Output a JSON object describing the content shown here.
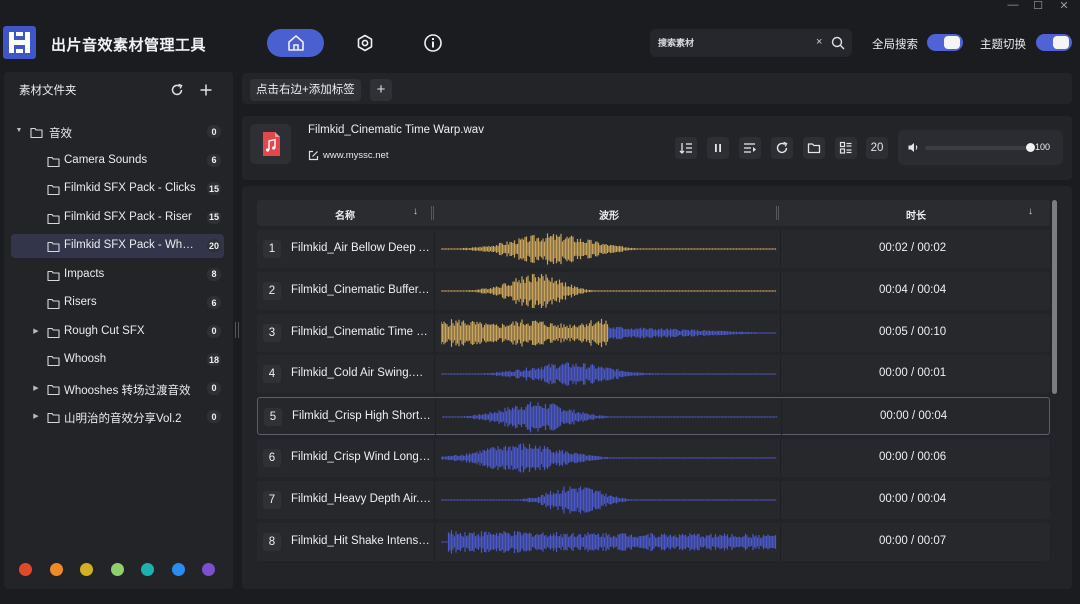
{
  "app": {
    "title": "出片音效素材管理工具",
    "logo_letter": "H"
  },
  "nav": {
    "home_icon": "home-icon",
    "settings_icon": "gear-icon",
    "info_icon": "info-icon",
    "active": "home"
  },
  "search": {
    "placeholder": "搜索素材",
    "clear": "×"
  },
  "toggles": {
    "global_search_label": "全局搜索",
    "global_search_on": true,
    "theme_switch_label": "主题切换",
    "theme_switch_on": true
  },
  "sidebar": {
    "header": "素材文件夹",
    "refresh_icon": "⟳",
    "add_icon": "+",
    "items": [
      {
        "label": "音效",
        "count": "0",
        "depth": 0,
        "expandable": true,
        "expanded": true
      },
      {
        "label": "Camera Sounds",
        "count": "6",
        "depth": 1,
        "expandable": false
      },
      {
        "label": "Filmkid SFX Pack - Clicks",
        "count": "15",
        "depth": 1,
        "expandable": false
      },
      {
        "label": "Filmkid SFX Pack - Riser",
        "count": "15",
        "depth": 1,
        "expandable": false
      },
      {
        "label": "Filmkid SFX Pack - Whoosh",
        "count": "20",
        "depth": 1,
        "expandable": false,
        "selected": true
      },
      {
        "label": "Impacts",
        "count": "8",
        "depth": 1,
        "expandable": false
      },
      {
        "label": "Risers",
        "count": "6",
        "depth": 1,
        "expandable": false
      },
      {
        "label": "Rough Cut SFX",
        "count": "0",
        "depth": 1,
        "expandable": true
      },
      {
        "label": "Whoosh",
        "count": "18",
        "depth": 1,
        "expandable": false
      },
      {
        "label": "Whooshes 转场过渡音效",
        "count": "0",
        "depth": 1,
        "expandable": true
      },
      {
        "label": "山明治的音效分享Vol.2",
        "count": "0",
        "depth": 1,
        "expandable": true
      }
    ],
    "color_tags": [
      "#e0492a",
      "#f08a24",
      "#d4b020",
      "#8fd06a",
      "#1fb0b0",
      "#2a8cf0",
      "#7a4fd0"
    ]
  },
  "tagbar": {
    "add_tag_label": "点击右边+添加标签",
    "plus": "+"
  },
  "player": {
    "file_name": "Filmkid_Cinematic Time Warp.wav",
    "site": "www.myssc.net",
    "count_badge": "20",
    "volume": 100,
    "volume_label": "100"
  },
  "table": {
    "columns": {
      "name": "名称",
      "waveform": "波形",
      "duration": "时长"
    },
    "sort_icon": "↓",
    "rows": [
      {
        "index": "1",
        "name": "Filmkid_Air Bellow Deep Airy.wav",
        "duration": "00:02 / 00:02",
        "progress": 1.0,
        "shape": "mid"
      },
      {
        "index": "2",
        "name": "Filmkid_Cinematic Buffer.wav",
        "duration": "00:04 / 00:04",
        "progress": 1.0,
        "shape": "left-mid"
      },
      {
        "index": "3",
        "name": "Filmkid_Cinematic Time Warp.wav",
        "duration": "00:05 / 00:10",
        "progress": 0.5,
        "shape": "dense"
      },
      {
        "index": "4",
        "name": "Filmkid_Cold Air Swing.wav",
        "duration": "00:00 / 00:01",
        "progress": 0.0,
        "shape": "mid-right"
      },
      {
        "index": "5",
        "name": "Filmkid_Crisp High Short.wav",
        "duration": "00:00 / 00:04",
        "progress": 0.0,
        "shape": "left",
        "selected": true
      },
      {
        "index": "6",
        "name": "Filmkid_Crisp Wind Long.wav",
        "duration": "00:00 / 00:06",
        "progress": 0.0,
        "shape": "left-mid2"
      },
      {
        "index": "7",
        "name": "Filmkid_Heavy Depth Air.wav",
        "duration": "00:00 / 00:04",
        "progress": 0.0,
        "shape": "center"
      },
      {
        "index": "8",
        "name": "Filmkid_Hit Shake Intense.wav",
        "duration": "00:00 / 00:07",
        "progress": 0.0,
        "shape": "full"
      }
    ]
  },
  "colors": {
    "accent": "#4a5fd0",
    "played_wave": "#c9a45a",
    "unplayed_wave": "#4a58c8"
  }
}
